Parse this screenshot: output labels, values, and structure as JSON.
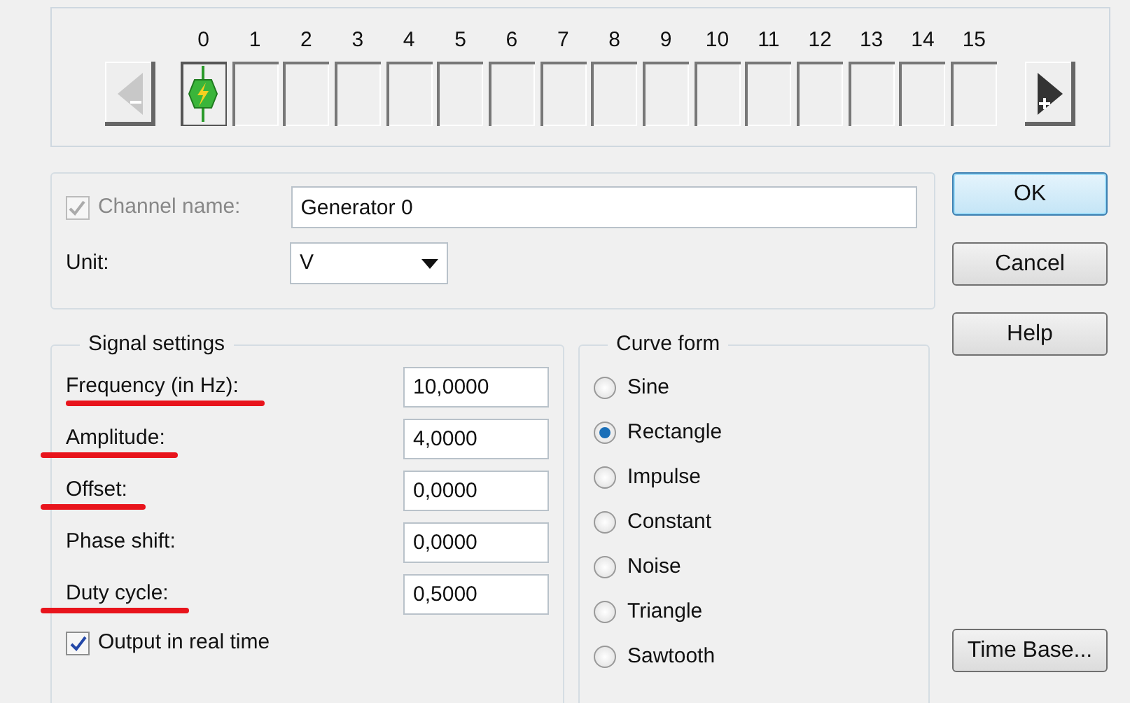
{
  "channel_strip": {
    "prev_button": {
      "disabled": true
    },
    "slots": [
      {
        "label": "0",
        "occupied": true,
        "selected": true
      },
      {
        "label": "1",
        "occupied": false,
        "selected": false
      },
      {
        "label": "2",
        "occupied": false,
        "selected": false
      },
      {
        "label": "3",
        "occupied": false,
        "selected": false
      },
      {
        "label": "4",
        "occupied": false,
        "selected": false
      },
      {
        "label": "5",
        "occupied": false,
        "selected": false
      },
      {
        "label": "6",
        "occupied": false,
        "selected": false
      },
      {
        "label": "7",
        "occupied": false,
        "selected": false
      },
      {
        "label": "8",
        "occupied": false,
        "selected": false
      },
      {
        "label": "9",
        "occupied": false,
        "selected": false
      },
      {
        "label": "10",
        "occupied": false,
        "selected": false
      },
      {
        "label": "11",
        "occupied": false,
        "selected": false
      },
      {
        "label": "12",
        "occupied": false,
        "selected": false
      },
      {
        "label": "13",
        "occupied": false,
        "selected": false
      },
      {
        "label": "14",
        "occupied": false,
        "selected": false
      },
      {
        "label": "15",
        "occupied": false,
        "selected": false
      }
    ],
    "next_button": {
      "disabled": false
    }
  },
  "channel": {
    "name_label": "Channel name:",
    "name_checked": true,
    "name_check_disabled": true,
    "name_value": "Generator 0",
    "unit_label": "Unit:",
    "unit_value": "V"
  },
  "signal_settings": {
    "title": "Signal settings",
    "fields": [
      {
        "label": "Frequency (in Hz):",
        "value": "10,0000",
        "underlined": true
      },
      {
        "label": "Amplitude:",
        "value": "4,0000",
        "underlined": true
      },
      {
        "label": "Offset:",
        "value": "0,0000",
        "underlined": true
      },
      {
        "label": "Phase shift:",
        "value": "0,0000",
        "underlined": false
      },
      {
        "label": "Duty cycle:",
        "value": "0,5000",
        "underlined": true
      }
    ],
    "realtime": {
      "label": "Output in real time",
      "checked": true
    }
  },
  "curve_form": {
    "title": "Curve form",
    "options": [
      {
        "label": "Sine",
        "selected": false
      },
      {
        "label": "Rectangle",
        "selected": true
      },
      {
        "label": "Impulse",
        "selected": false
      },
      {
        "label": "Constant",
        "selected": false
      },
      {
        "label": "Noise",
        "selected": false
      },
      {
        "label": "Triangle",
        "selected": false
      },
      {
        "label": "Sawtooth",
        "selected": false
      }
    ]
  },
  "buttons": [
    {
      "label": "OK",
      "default": true
    },
    {
      "label": "Cancel",
      "default": false
    },
    {
      "label": "Help",
      "default": false
    }
  ],
  "time_base_button": "Time Base..."
}
